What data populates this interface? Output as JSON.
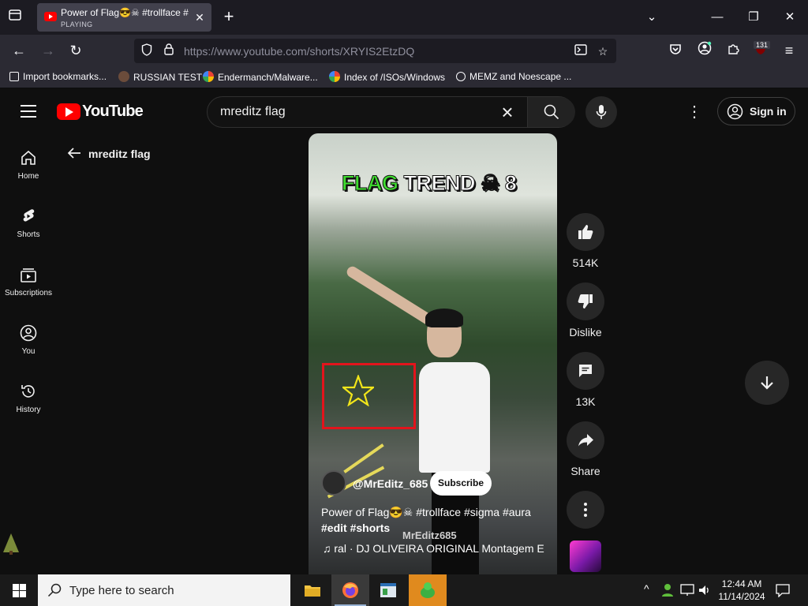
{
  "browser": {
    "tab": {
      "title": "Power of Flag😎☠ #trollface #",
      "status": "PLAYING"
    },
    "url": "https://www.youtube.com/shorts/XRYIS2EtzDQ",
    "extension_badge": "131",
    "bookmarks": [
      "Import bookmarks...",
      "RUSSIAN TEST",
      "Endermanch/Malware...",
      "Index of /ISOs/Windows",
      "MEMZ and Noescape ..."
    ]
  },
  "youtube": {
    "logo_text": "YouTube",
    "search_value": "mreditz flag",
    "sign_in_label": "Sign in",
    "sidebar": [
      {
        "label": "Home",
        "icon": "home-icon"
      },
      {
        "label": "Shorts",
        "icon": "shorts-icon"
      },
      {
        "label": "Subscriptions",
        "icon": "subscriptions-icon"
      },
      {
        "label": "You",
        "icon": "you-icon"
      },
      {
        "label": "History",
        "icon": "history-icon"
      }
    ],
    "back_title": "mreditz flag",
    "short": {
      "overlay_text_green": "FLAG",
      "overlay_text_white": "TREND ☠ 8",
      "channel": "@MrEditz_685",
      "subscribe_label": "Subscribe",
      "description_line1": "Power of Flag😎☠ #trollface #sigma #aura",
      "description_line2": "#edit #shorts",
      "watermark": "MrEditz685",
      "music": "ral · DJ OLIVEIRA ORIGINAL    Montagem E"
    },
    "actions": {
      "like_count": "514K",
      "dislike_label": "Dislike",
      "comment_count": "13K",
      "share_label": "Share"
    }
  },
  "taskbar": {
    "search_placeholder": "Type here to search",
    "time": "12:44 AM",
    "date": "11/14/2024"
  },
  "colors": {
    "yt_red": "#ff0000",
    "annotation_red": "#e3141c",
    "star_yellow": "#f2e61a",
    "flag_green": "#3fdc2f"
  }
}
